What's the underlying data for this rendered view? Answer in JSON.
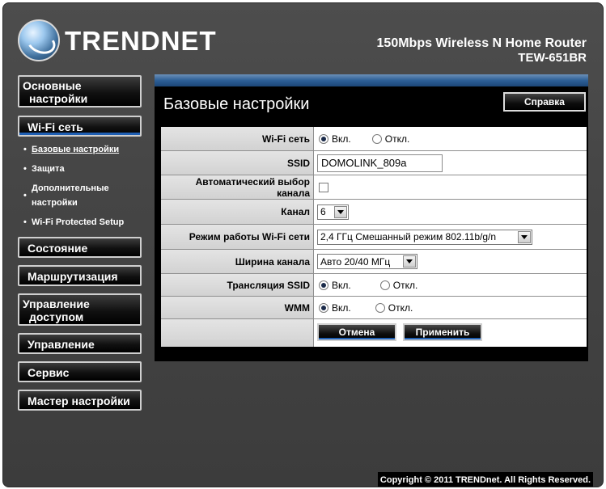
{
  "header": {
    "brand": "TRENDNET",
    "product_line": "150Mbps Wireless N Home Router",
    "model": "TEW-651BR"
  },
  "sidebar": {
    "items": [
      {
        "label": "Основные\nнастройки"
      },
      {
        "label": "Wi-Fi сеть"
      },
      {
        "label": "Состояние"
      },
      {
        "label": "Маршрутизация"
      },
      {
        "label": "Управление\nдоступом"
      },
      {
        "label": "Управление"
      },
      {
        "label": "Сервис"
      },
      {
        "label": "Мастер настройки"
      }
    ],
    "submenu": [
      {
        "label": "Базовые настройки"
      },
      {
        "label": "Защита"
      },
      {
        "label": "Дополнительные\nнастройки"
      },
      {
        "label": "Wi-Fi Protected Setup"
      }
    ]
  },
  "main": {
    "title": "Базовые настройки",
    "help_label": "Справка",
    "fields": {
      "wifi": {
        "label": "Wi-Fi сеть",
        "on": "Вкл.",
        "off": "Откл.",
        "selected": "on"
      },
      "ssid": {
        "label": "SSID",
        "value": "DOMOLINK_809a"
      },
      "auto_channel": {
        "label": "Автоматический выбор канала",
        "checked": false
      },
      "channel": {
        "label": "Канал",
        "value": "6"
      },
      "mode": {
        "label": "Режим работы Wi-Fi сети",
        "value": "2,4 ГГц Смешанный режим 802.11b/g/n"
      },
      "width": {
        "label": "Ширина канала",
        "value": "Авто 20/40 МГц"
      },
      "ssid_broadcast": {
        "label": "Трансляция SSID",
        "on": "Вкл.",
        "off": "Откл.",
        "selected": "on"
      },
      "wmm": {
        "label": "WMM",
        "on": "Вкл.",
        "off": "Откл.",
        "selected": "on"
      }
    },
    "cancel_label": "Отмена",
    "apply_label": "Применить"
  },
  "footer": {
    "copyright": "Copyright © 2011 TRENDnet. All Rights Reserved."
  }
}
